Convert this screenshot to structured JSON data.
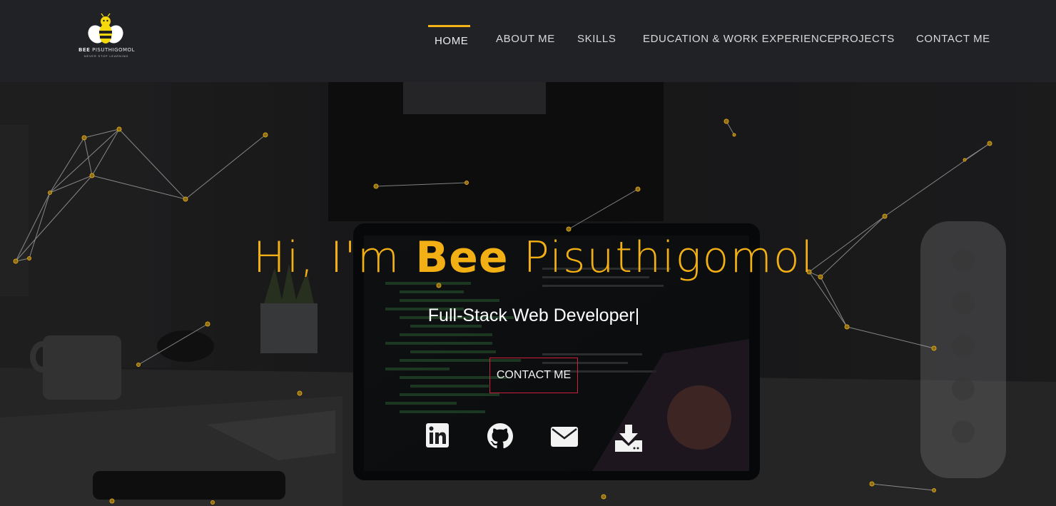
{
  "brand": {
    "name_bold": "BEE",
    "name_rest": " PISUTHIGOMOL",
    "tagline": "NEVER STOP LEARNING"
  },
  "nav": {
    "items": [
      {
        "label": "HOME",
        "active": true
      },
      {
        "label": "ABOUT ME",
        "active": false
      },
      {
        "label": "SKILLS",
        "active": false
      },
      {
        "label": "EDUCATION & WORK EXPERIENCE",
        "active": false
      },
      {
        "label": "PROJECTS",
        "active": false
      },
      {
        "label": "CONTACT ME",
        "active": false
      }
    ]
  },
  "hero": {
    "greeting": "Hi, I'm ",
    "name_bold": "Bee",
    "name_rest": " Pisuthigomol",
    "subtitle": "Full-Stack Web Developer|",
    "cta_label": "CONTACT ME"
  },
  "social": [
    {
      "icon": "linkedin-icon"
    },
    {
      "icon": "github-icon"
    },
    {
      "icon": "email-icon"
    },
    {
      "icon": "download-icon"
    }
  ],
  "colors": {
    "accent": "#f5b318",
    "header_bg": "#212226",
    "cta_border": "#d01f3c",
    "text": "#ffffff"
  }
}
